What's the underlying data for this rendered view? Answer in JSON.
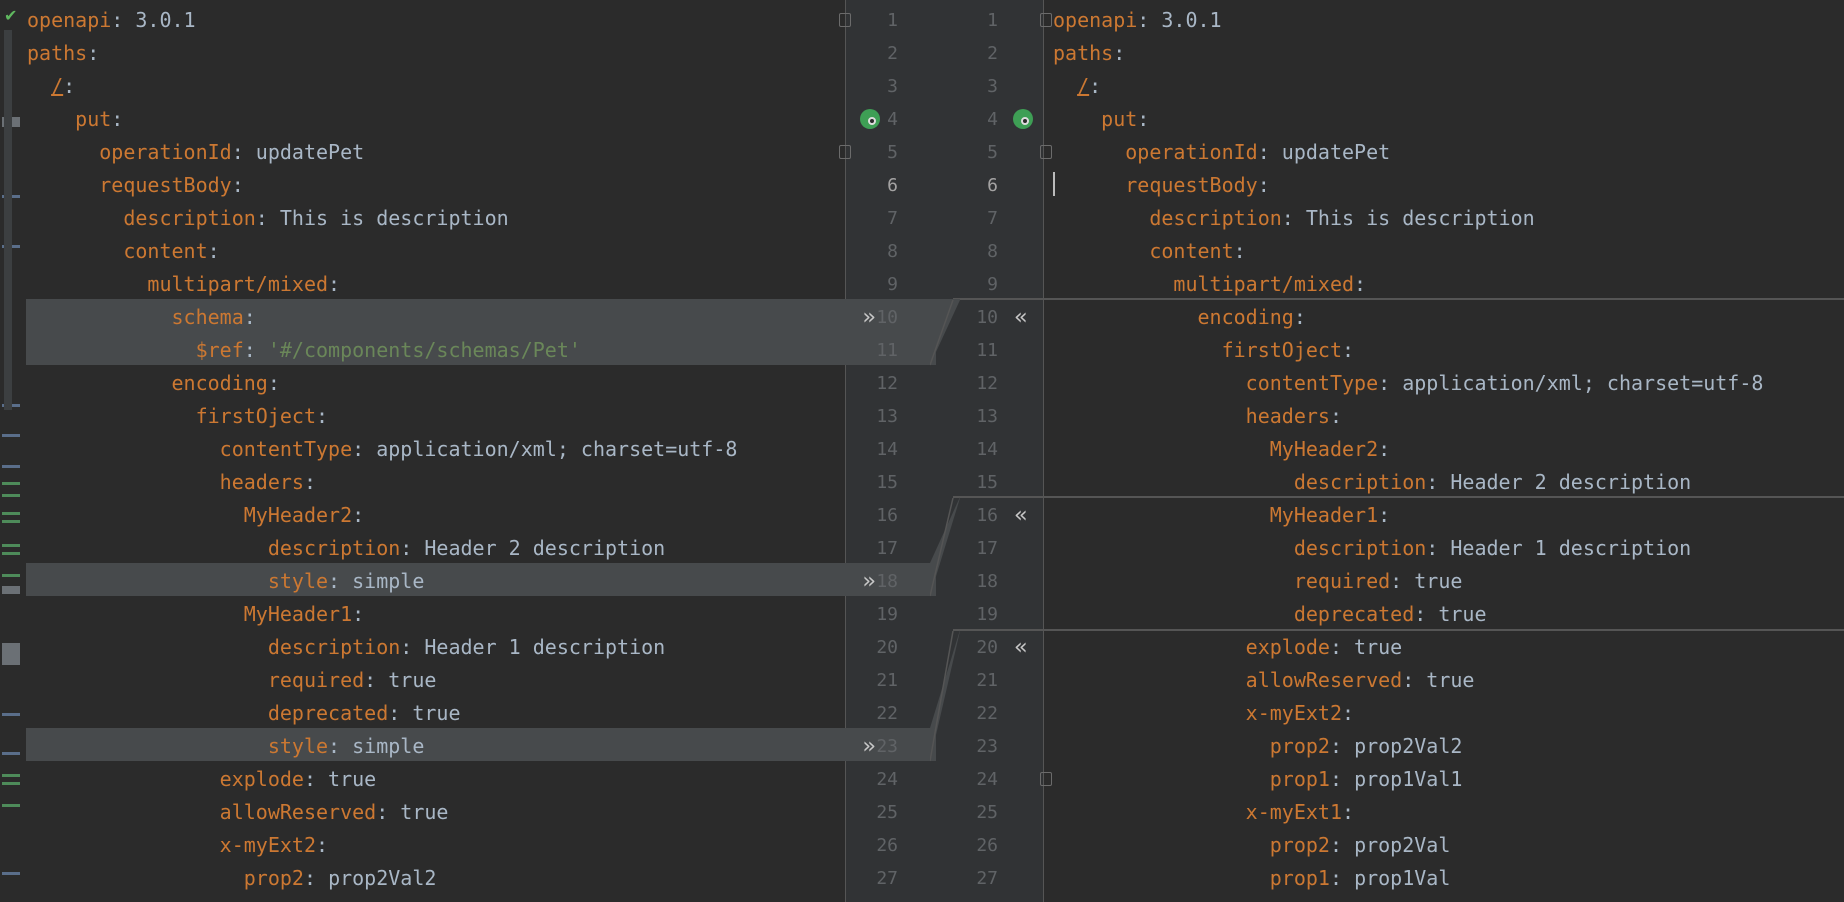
{
  "left": {
    "lines": [
      [
        {
          "t": "openapi",
          "c": "k"
        },
        {
          "t": ": ",
          "c": "p"
        },
        {
          "t": "3.0.1",
          "c": "v"
        }
      ],
      [
        {
          "t": "paths",
          "c": "k"
        },
        {
          "t": ":",
          "c": "p"
        }
      ],
      [
        {
          "t": "  "
        },
        {
          "t": "/",
          "c": "u"
        },
        {
          "t": ":",
          "c": "p"
        }
      ],
      [
        {
          "t": "    "
        },
        {
          "t": "put",
          "c": "k"
        },
        {
          "t": ":",
          "c": "p"
        }
      ],
      [
        {
          "t": "      "
        },
        {
          "t": "operationId",
          "c": "k"
        },
        {
          "t": ": ",
          "c": "p"
        },
        {
          "t": "updatePet",
          "c": "v"
        }
      ],
      [
        {
          "t": "      "
        },
        {
          "t": "requestBody",
          "c": "k"
        },
        {
          "t": ":",
          "c": "p"
        }
      ],
      [
        {
          "t": "        "
        },
        {
          "t": "description",
          "c": "k"
        },
        {
          "t": ": ",
          "c": "p"
        },
        {
          "t": "This is description",
          "c": "v"
        }
      ],
      [
        {
          "t": "        "
        },
        {
          "t": "content",
          "c": "k"
        },
        {
          "t": ":",
          "c": "p"
        }
      ],
      [
        {
          "t": "          "
        },
        {
          "t": "multipart/mixed",
          "c": "k"
        },
        {
          "t": ":",
          "c": "p"
        }
      ],
      [
        {
          "t": "            "
        },
        {
          "t": "schema",
          "c": "k"
        },
        {
          "t": ":",
          "c": "p"
        }
      ],
      [
        {
          "t": "              "
        },
        {
          "t": "$ref",
          "c": "k"
        },
        {
          "t": ": ",
          "c": "p"
        },
        {
          "t": "'#/components/schemas/Pet'",
          "c": "s"
        }
      ],
      [
        {
          "t": "            "
        },
        {
          "t": "encoding",
          "c": "k"
        },
        {
          "t": ":",
          "c": "p"
        }
      ],
      [
        {
          "t": "              "
        },
        {
          "t": "firstOject",
          "c": "k"
        },
        {
          "t": ":",
          "c": "p"
        }
      ],
      [
        {
          "t": "                "
        },
        {
          "t": "contentType",
          "c": "k"
        },
        {
          "t": ": ",
          "c": "p"
        },
        {
          "t": "application/xml; charset=utf-8",
          "c": "v"
        }
      ],
      [
        {
          "t": "                "
        },
        {
          "t": "headers",
          "c": "k"
        },
        {
          "t": ":",
          "c": "p"
        }
      ],
      [
        {
          "t": "                  "
        },
        {
          "t": "MyHeader2",
          "c": "k"
        },
        {
          "t": ":",
          "c": "p"
        }
      ],
      [
        {
          "t": "                    "
        },
        {
          "t": "description",
          "c": "k"
        },
        {
          "t": ": ",
          "c": "p"
        },
        {
          "t": "Header 2 description",
          "c": "v"
        }
      ],
      [
        {
          "t": "                    "
        },
        {
          "t": "style",
          "c": "k"
        },
        {
          "t": ": ",
          "c": "p"
        },
        {
          "t": "simple",
          "c": "v"
        }
      ],
      [
        {
          "t": "                  "
        },
        {
          "t": "MyHeader1",
          "c": "k"
        },
        {
          "t": ":",
          "c": "p"
        }
      ],
      [
        {
          "t": "                    "
        },
        {
          "t": "description",
          "c": "k"
        },
        {
          "t": ": ",
          "c": "p"
        },
        {
          "t": "Header 1 description",
          "c": "v"
        }
      ],
      [
        {
          "t": "                    "
        },
        {
          "t": "required",
          "c": "k"
        },
        {
          "t": ": ",
          "c": "p"
        },
        {
          "t": "true",
          "c": "v"
        }
      ],
      [
        {
          "t": "                    "
        },
        {
          "t": "deprecated",
          "c": "k"
        },
        {
          "t": ": ",
          "c": "p"
        },
        {
          "t": "true",
          "c": "v"
        }
      ],
      [
        {
          "t": "                    "
        },
        {
          "t": "style",
          "c": "k"
        },
        {
          "t": ": ",
          "c": "p"
        },
        {
          "t": "simple",
          "c": "v"
        }
      ],
      [
        {
          "t": "                "
        },
        {
          "t": "explode",
          "c": "k"
        },
        {
          "t": ": ",
          "c": "p"
        },
        {
          "t": "true",
          "c": "v"
        }
      ],
      [
        {
          "t": "                "
        },
        {
          "t": "allowReserved",
          "c": "k"
        },
        {
          "t": ": ",
          "c": "p"
        },
        {
          "t": "true",
          "c": "v"
        }
      ],
      [
        {
          "t": "                "
        },
        {
          "t": "x-myExt2",
          "c": "k"
        },
        {
          "t": ":",
          "c": "p"
        }
      ],
      [
        {
          "t": "                  "
        },
        {
          "t": "prop2",
          "c": "k"
        },
        {
          "t": ": ",
          "c": "p"
        },
        {
          "t": "prop2Val2",
          "c": "v"
        }
      ]
    ]
  },
  "right": {
    "lines": [
      [
        {
          "t": "openapi",
          "c": "k"
        },
        {
          "t": ": ",
          "c": "p"
        },
        {
          "t": "3.0.1",
          "c": "v"
        }
      ],
      [
        {
          "t": "paths",
          "c": "k"
        },
        {
          "t": ":",
          "c": "p"
        }
      ],
      [
        {
          "t": "  "
        },
        {
          "t": "/",
          "c": "u"
        },
        {
          "t": ":",
          "c": "p"
        }
      ],
      [
        {
          "t": "    "
        },
        {
          "t": "put",
          "c": "k"
        },
        {
          "t": ":",
          "c": "p"
        }
      ],
      [
        {
          "t": "      "
        },
        {
          "t": "operationId",
          "c": "k"
        },
        {
          "t": ": ",
          "c": "p"
        },
        {
          "t": "updatePet",
          "c": "v"
        }
      ],
      [
        {
          "t": "      "
        },
        {
          "t": "requestBody",
          "c": "k"
        },
        {
          "t": ":",
          "c": "p"
        }
      ],
      [
        {
          "t": "        "
        },
        {
          "t": "description",
          "c": "k"
        },
        {
          "t": ": ",
          "c": "p"
        },
        {
          "t": "This is description",
          "c": "v"
        }
      ],
      [
        {
          "t": "        "
        },
        {
          "t": "content",
          "c": "k"
        },
        {
          "t": ":",
          "c": "p"
        }
      ],
      [
        {
          "t": "          "
        },
        {
          "t": "multipart/mixed",
          "c": "k"
        },
        {
          "t": ":",
          "c": "p"
        }
      ],
      [
        {
          "t": "            "
        },
        {
          "t": "encoding",
          "c": "k"
        },
        {
          "t": ":",
          "c": "p"
        }
      ],
      [
        {
          "t": "              "
        },
        {
          "t": "firstOject",
          "c": "k"
        },
        {
          "t": ":",
          "c": "p"
        }
      ],
      [
        {
          "t": "                "
        },
        {
          "t": "contentType",
          "c": "k"
        },
        {
          "t": ": ",
          "c": "p"
        },
        {
          "t": "application/xml; charset=utf-8",
          "c": "v"
        }
      ],
      [
        {
          "t": "                "
        },
        {
          "t": "headers",
          "c": "k"
        },
        {
          "t": ":",
          "c": "p"
        }
      ],
      [
        {
          "t": "                  "
        },
        {
          "t": "MyHeader2",
          "c": "k"
        },
        {
          "t": ":",
          "c": "p"
        }
      ],
      [
        {
          "t": "                    "
        },
        {
          "t": "description",
          "c": "k"
        },
        {
          "t": ": ",
          "c": "p"
        },
        {
          "t": "Header 2 description",
          "c": "v"
        }
      ],
      [
        {
          "t": "                  "
        },
        {
          "t": "MyHeader1",
          "c": "k"
        },
        {
          "t": ":",
          "c": "p"
        }
      ],
      [
        {
          "t": "                    "
        },
        {
          "t": "description",
          "c": "k"
        },
        {
          "t": ": ",
          "c": "p"
        },
        {
          "t": "Header 1 description",
          "c": "v"
        }
      ],
      [
        {
          "t": "                    "
        },
        {
          "t": "required",
          "c": "k"
        },
        {
          "t": ": ",
          "c": "p"
        },
        {
          "t": "true",
          "c": "v"
        }
      ],
      [
        {
          "t": "                    "
        },
        {
          "t": "deprecated",
          "c": "k"
        },
        {
          "t": ": ",
          "c": "p"
        },
        {
          "t": "true",
          "c": "v"
        }
      ],
      [
        {
          "t": "                "
        },
        {
          "t": "explode",
          "c": "k"
        },
        {
          "t": ": ",
          "c": "p"
        },
        {
          "t": "true",
          "c": "v"
        }
      ],
      [
        {
          "t": "                "
        },
        {
          "t": "allowReserved",
          "c": "k"
        },
        {
          "t": ": ",
          "c": "p"
        },
        {
          "t": "true",
          "c": "v"
        }
      ],
      [
        {
          "t": "                "
        },
        {
          "t": "x-myExt2",
          "c": "k"
        },
        {
          "t": ":",
          "c": "p"
        }
      ],
      [
        {
          "t": "                  "
        },
        {
          "t": "prop2",
          "c": "k"
        },
        {
          "t": ": ",
          "c": "p"
        },
        {
          "t": "prop2Val2",
          "c": "v"
        }
      ],
      [
        {
          "t": "                  "
        },
        {
          "t": "prop1",
          "c": "k"
        },
        {
          "t": ": ",
          "c": "p"
        },
        {
          "t": "prop1Val1",
          "c": "v"
        }
      ],
      [
        {
          "t": "                "
        },
        {
          "t": "x-myExt1",
          "c": "k"
        },
        {
          "t": ":",
          "c": "p"
        }
      ],
      [
        {
          "t": "                  "
        },
        {
          "t": "prop2",
          "c": "k"
        },
        {
          "t": ": ",
          "c": "p"
        },
        {
          "t": "prop2Val",
          "c": "v"
        }
      ],
      [
        {
          "t": "                  "
        },
        {
          "t": "prop1",
          "c": "k"
        },
        {
          "t": ": ",
          "c": "p"
        },
        {
          "t": "prop1Val",
          "c": "v"
        }
      ]
    ]
  },
  "line_numbers": [
    "1",
    "2",
    "3",
    "4",
    "5",
    "6",
    "7",
    "8",
    "9",
    "10",
    "11",
    "12",
    "13",
    "14",
    "15",
    "16",
    "17",
    "18",
    "19",
    "20",
    "21",
    "22",
    "23",
    "24",
    "25",
    "26",
    "27"
  ],
  "current_line": "6",
  "colors": {
    "background": "#2b2b2b",
    "gutter": "#313335",
    "key": "#cc7832",
    "text": "#a9b7c6",
    "string": "#6a8759",
    "changed_block": "#474a4c"
  },
  "icons": {
    "inspection": "check-mark-icon",
    "apply_left": "double-chevron-right-icon",
    "apply_right": "double-chevron-left-icon",
    "implement": "implement-method-icon",
    "fold": "fold-marker-icon"
  }
}
